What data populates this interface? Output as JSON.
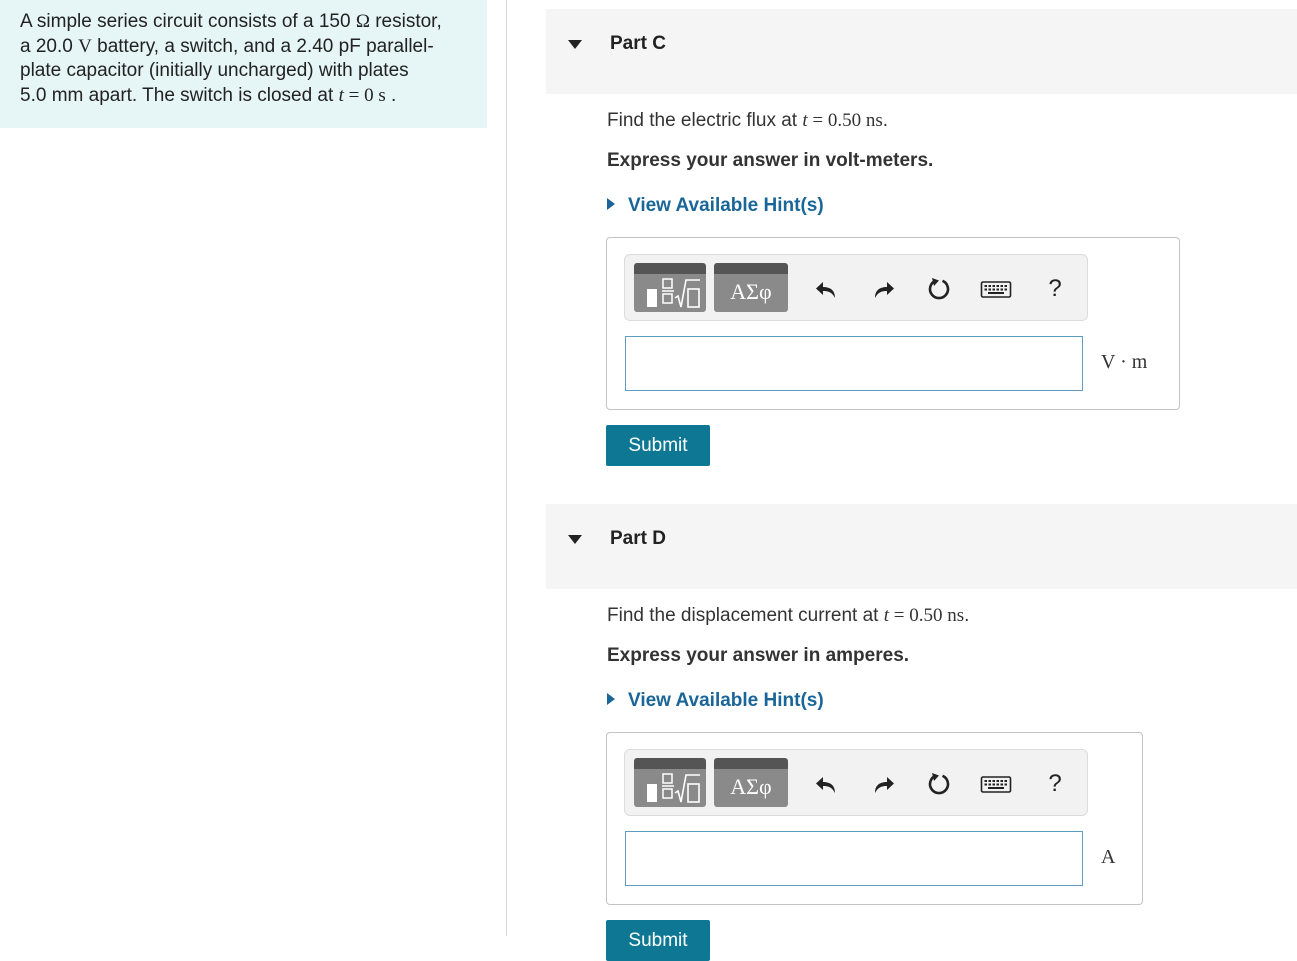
{
  "problem": {
    "line1_a": "A simple series circuit consists of a 150 ",
    "line1_ohm": "Ω",
    "line1_b": " resistor,",
    "line2_a": "a 20.0 ",
    "line2_v": "V",
    "line2_b": " battery, a switch, and a 2.40 pF parallel-",
    "line3": "plate capacitor (initially uncharged) with plates",
    "line4_a": "5.0 mm apart. The switch is closed at ",
    "line4_t": "t",
    "line4_eq": " = ",
    "line4_val": "0 s",
    "line4_end": " ."
  },
  "parts": [
    {
      "title": "Part C",
      "question_a": "Find the electric flux at ",
      "question_t": "t",
      "question_eq": " = ",
      "question_val": "0.50 ns",
      "question_end": ".",
      "express": "Express your answer in volt-meters.",
      "hint": "View Available Hint(s)",
      "symbols_label": "ΑΣφ",
      "help_label": "?",
      "unit": "V · m",
      "answer_value": "",
      "submit_label": "Submit"
    },
    {
      "title": "Part D",
      "question_a": "Find the displacement current at ",
      "question_t": "t",
      "question_eq": " = ",
      "question_val": "0.50 ns",
      "question_end": ".",
      "express": "Express your answer in amperes.",
      "hint": "View Available Hint(s)",
      "symbols_label": "ΑΣφ",
      "help_label": "?",
      "unit": "A",
      "answer_value": "",
      "submit_label": "Submit"
    }
  ]
}
